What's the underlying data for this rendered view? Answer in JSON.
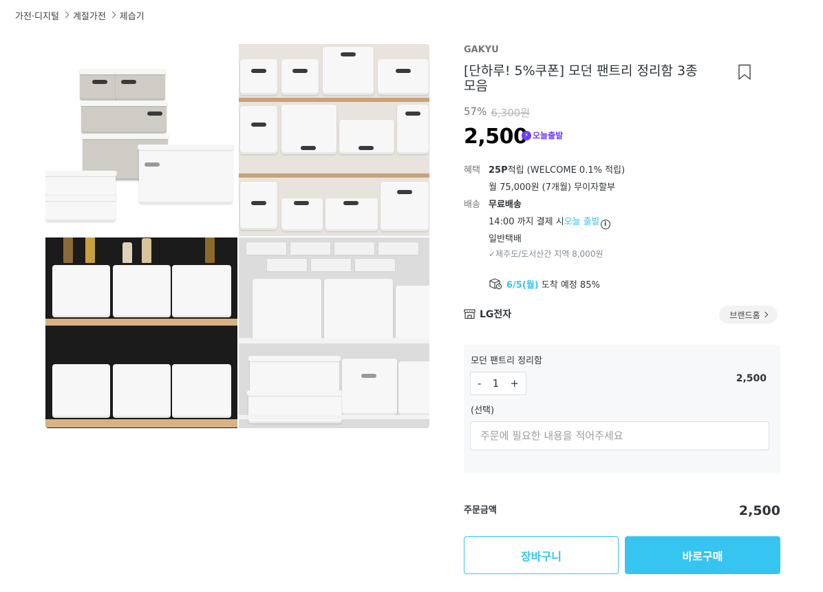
{
  "breadcrumb": [
    "가전·디지털",
    "계절가전",
    "제습기"
  ],
  "product": {
    "brand": "GAKYU",
    "title": "[단하루! 5%쿠폰] 모던 팬트리 정리함 3종 모음",
    "discount_rate": "57%",
    "original_price": "6,300원",
    "price": "2,500",
    "today_badge": "오늘출발"
  },
  "benefits": {
    "label": "혜택",
    "points_bold": "25P",
    "points_text": "적립 (WELCOME 0.1% 적립)",
    "installment": "월 75,000원 (7개월) 무이자할부"
  },
  "shipping": {
    "label": "배송",
    "type": "무료배송",
    "deadline_prefix": "14:00 까지 결제 시",
    "deadline_highlight": "오늘 출발",
    "method": "일반택배",
    "extra": "제주도/도서산간 지역 8,000원",
    "arrival_date": "6/5(월)",
    "arrival_text": "도착 예정 85%"
  },
  "seller": {
    "name": "LG전자",
    "home_label": "브랜드홈"
  },
  "option": {
    "name": "모던 팬트리 정리함",
    "minus": "-",
    "quantity": "1",
    "plus": "+",
    "price": "2,500",
    "select_label": "(선택)",
    "request_placeholder": "주문에 필요한 내용을 적어주세요"
  },
  "order": {
    "total_label": "주문금액",
    "total_value": "2,500",
    "cart_label": "장바구니",
    "buy_label": "바로구매"
  },
  "icons": {
    "breadcrumb_separator": "chevron-right-icon",
    "bookmark": "bookmark-icon",
    "today_badge": "lightning-icon",
    "info": "info-icon",
    "delivery": "delivery-box-icon",
    "store": "store-icon",
    "brand_home": "chevron-right-icon"
  },
  "colors": {
    "accent": "#35c5f0",
    "badge_purple": "#6a3dff",
    "text_main": "#2f3438"
  }
}
